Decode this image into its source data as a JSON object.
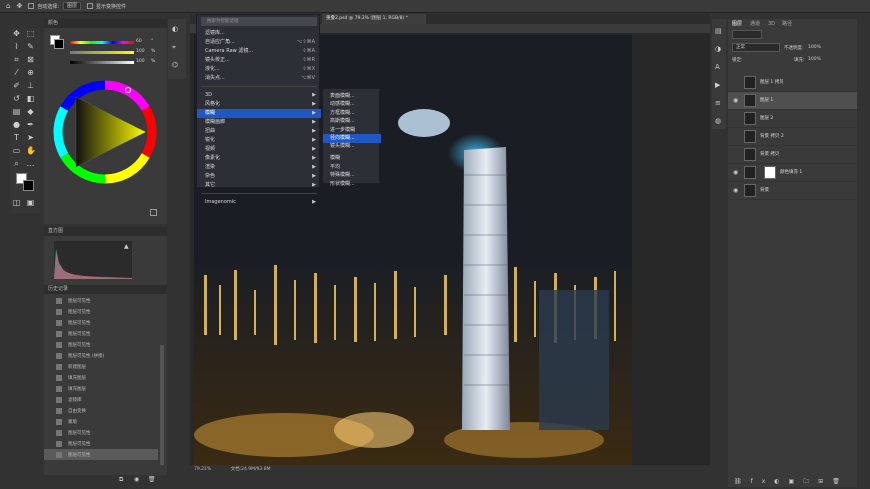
{
  "optionsbar": {
    "auto_select_label": "自动选择:",
    "auto_select_value": "图层",
    "show_transform_label": "显示变换控件"
  },
  "panels": {
    "color_tab": "颜色",
    "histogram_tab": "直方图",
    "history_tab": "历史记录",
    "color_values": [
      "60",
      "100",
      "100"
    ],
    "color_units": [
      "°",
      "%",
      "%"
    ]
  },
  "history": {
    "items": [
      {
        "label": "图层可见性"
      },
      {
        "label": "图层可见性"
      },
      {
        "label": "图层可见性"
      },
      {
        "label": "图层可见性"
      },
      {
        "label": "图层可见性"
      },
      {
        "label": "图层可见性 (拼接)"
      },
      {
        "label": "新建图层"
      },
      {
        "label": "填充图层"
      },
      {
        "label": "填充图层"
      },
      {
        "label": "滤镜库"
      },
      {
        "label": "自由变换"
      },
      {
        "label": "蒙版"
      },
      {
        "label": "图层可见性"
      },
      {
        "label": "图层可见性"
      },
      {
        "label": "图层可见性"
      }
    ]
  },
  "document": {
    "tab_title": "重叠2.psd @ 79.2% (图层 1, RGB/8) *",
    "zoom": "79.21%",
    "doc_size": "文档:24.9M/93.8M"
  },
  "filter_menu": {
    "search_placeholder": "搜索为智能滤镜",
    "items": [
      {
        "label": "滤镜库...",
        "shortcut": ""
      },
      {
        "label": "自适应广角...",
        "shortcut": "⌥⇧⌘A"
      },
      {
        "label": "Camera Raw 滤镜...",
        "shortcut": "⇧⌘A"
      },
      {
        "label": "镜头校正...",
        "shortcut": "⇧⌘R"
      },
      {
        "label": "液化...",
        "shortcut": "⇧⌘X"
      },
      {
        "label": "消失点...",
        "shortcut": "⌥⌘V"
      }
    ],
    "submenus": [
      {
        "label": "3D"
      },
      {
        "label": "风格化"
      },
      {
        "label": "模糊"
      },
      {
        "label": "模糊画廊"
      },
      {
        "label": "扭曲"
      },
      {
        "label": "锐化"
      },
      {
        "label": "视频"
      },
      {
        "label": "像素化"
      },
      {
        "label": "渲染"
      },
      {
        "label": "杂色"
      },
      {
        "label": "其它"
      }
    ],
    "plugin": "Imagenomic"
  },
  "blur_submenu": {
    "items": [
      {
        "label": "表面模糊..."
      },
      {
        "label": "动感模糊..."
      },
      {
        "label": "方框模糊..."
      },
      {
        "label": "高斯模糊..."
      },
      {
        "label": "进一步模糊"
      },
      {
        "label": "径向模糊..."
      },
      {
        "label": "镜头模糊..."
      },
      {
        "label": "模糊"
      },
      {
        "label": "平均"
      },
      {
        "label": "特殊模糊..."
      },
      {
        "label": "形状模糊..."
      }
    ]
  },
  "layers_panel": {
    "tabs": [
      "图层",
      "通道",
      "3D",
      "路径"
    ],
    "blend_mode": "正常",
    "opacity_label": "不透明度:",
    "opacity_value": "100%",
    "fill_label": "填充:",
    "fill_value": "100%",
    "lock_label": "锁定:",
    "layers": [
      {
        "name": "图层 1 拷贝"
      },
      {
        "name": "图层 1"
      },
      {
        "name": "图层 2"
      },
      {
        "name": "背景 拷贝 2"
      },
      {
        "name": "背景 拷贝"
      },
      {
        "name": "颜色填充 1"
      },
      {
        "name": "背景"
      }
    ]
  },
  "colors": {
    "accent": "#1f57c4",
    "panel": "#3a3a3a",
    "canvas_dark": "#1a1e24",
    "glow": "#3fb6e6"
  }
}
